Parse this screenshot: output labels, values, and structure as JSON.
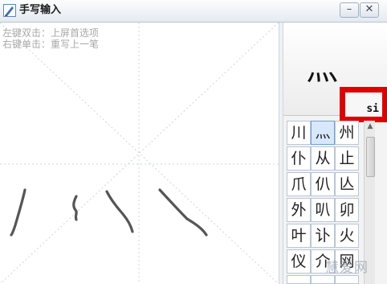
{
  "window": {
    "title": "手写输入",
    "min_label": "–",
    "close_label": "✕",
    "icons": {
      "app": "pen-icon",
      "minimize": "minimize-icon",
      "close": "close-icon"
    }
  },
  "canvas": {
    "hint_line1": "左键双击：上屏首选项",
    "hint_line2": "右键单击：重写上一笔"
  },
  "preview": {
    "char": "灬",
    "pinyin": "si"
  },
  "candidates": [
    [
      "川",
      "灬",
      "州"
    ],
    [
      "仆",
      "从",
      "止"
    ],
    [
      "爪",
      "仈",
      "亾"
    ],
    [
      "外",
      "叭",
      "卯"
    ],
    [
      "叶",
      "讣",
      "火"
    ],
    [
      "仪",
      "介",
      "网"
    ],
    [
      "",
      "",
      ""
    ]
  ],
  "selected_candidate": "灬",
  "watermark": "慧爱网",
  "colors": {
    "highlight_box": "#e00000",
    "selected_cell": "#d8e8fb"
  }
}
